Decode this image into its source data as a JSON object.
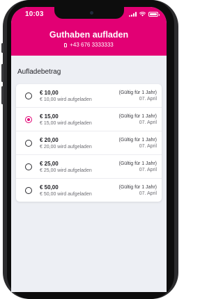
{
  "colors": {
    "accent": "#e20074",
    "background": "#edeff4",
    "card": "#ffffff"
  },
  "status_bar": {
    "time": "10:03",
    "icons": [
      "signal-icon",
      "wifi-icon",
      "battery-icon"
    ]
  },
  "header": {
    "title": "Guthaben aufladen",
    "phone_number": "+43 676 3333333",
    "number_icon": "sim-card-icon"
  },
  "section": {
    "title": "Aufladebetrag"
  },
  "options": [
    {
      "amount": "€ 10,00",
      "loaded": "€ 10,00 wird aufgeladen",
      "validity": "(Gültig für 1 Jahr)",
      "date": "07. April",
      "selected": false
    },
    {
      "amount": "€ 15,00",
      "loaded": "€ 15,00 wird aufgeladen",
      "validity": "(Gültig für 1 Jahr)",
      "date": "07. April",
      "selected": true
    },
    {
      "amount": "€ 20,00",
      "loaded": "€ 20,00 wird aufgeladen",
      "validity": "(Gültig für 1 Jahr)",
      "date": "07. April",
      "selected": false
    },
    {
      "amount": "€ 25,00",
      "loaded": "€ 25,00 wird aufgeladen",
      "validity": "(Gültig für 1 Jahr)",
      "date": "07. April",
      "selected": false
    },
    {
      "amount": "€ 50,00",
      "loaded": "€ 50,00 wird aufgeladen",
      "validity": "(Gültig für 1 Jahr)",
      "date": "07. April",
      "selected": false
    }
  ]
}
